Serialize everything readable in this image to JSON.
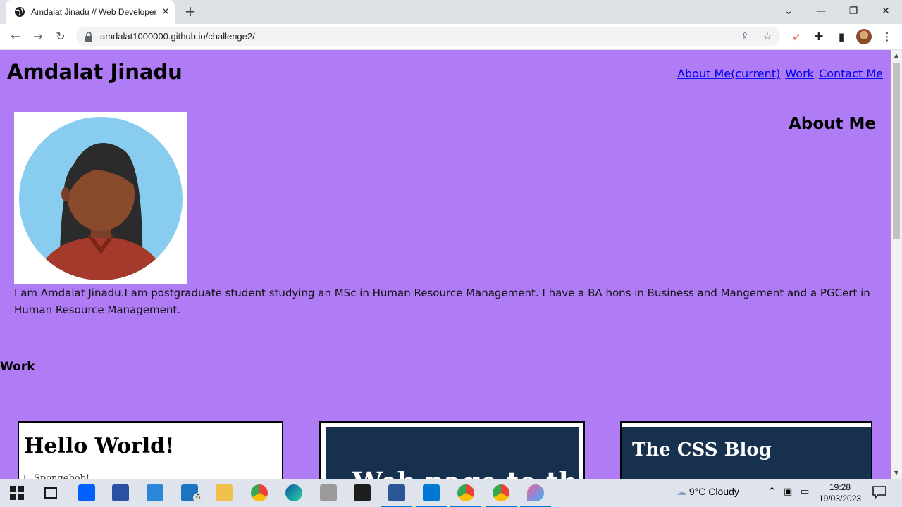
{
  "browser": {
    "tab_title": "Amdalat Jinadu // Web Developer",
    "new_tab_label": "+",
    "url": "amdalat1000000.github.io/challenge2/"
  },
  "page": {
    "site_title": "Amdalat Jinadu",
    "nav": [
      {
        "label": "About Me(current)"
      },
      {
        "label": "Work"
      },
      {
        "label": "Contact Me"
      }
    ],
    "about_heading": "About Me",
    "bio": "I am Amdalat Jinadu.I am postgraduate student studying an MSc in Human Resource Management. I have a BA hons in Business and Mangement and a PGCert in Human Resource Management.",
    "work_heading": "Work",
    "cards": [
      {
        "title": "Hello World!",
        "alt_text": "Spongebob!"
      },
      {
        "title": "Web page to th"
      },
      {
        "title": "The CSS Blog"
      }
    ]
  },
  "taskbar": {
    "mail_badge": "6",
    "weather": "9°C  Cloudy",
    "time": "19:28",
    "date": "19/03/2023"
  },
  "colors": {
    "page_bg": "#b07cf5",
    "link": "#0000ee",
    "card_dark": "#17304d"
  }
}
